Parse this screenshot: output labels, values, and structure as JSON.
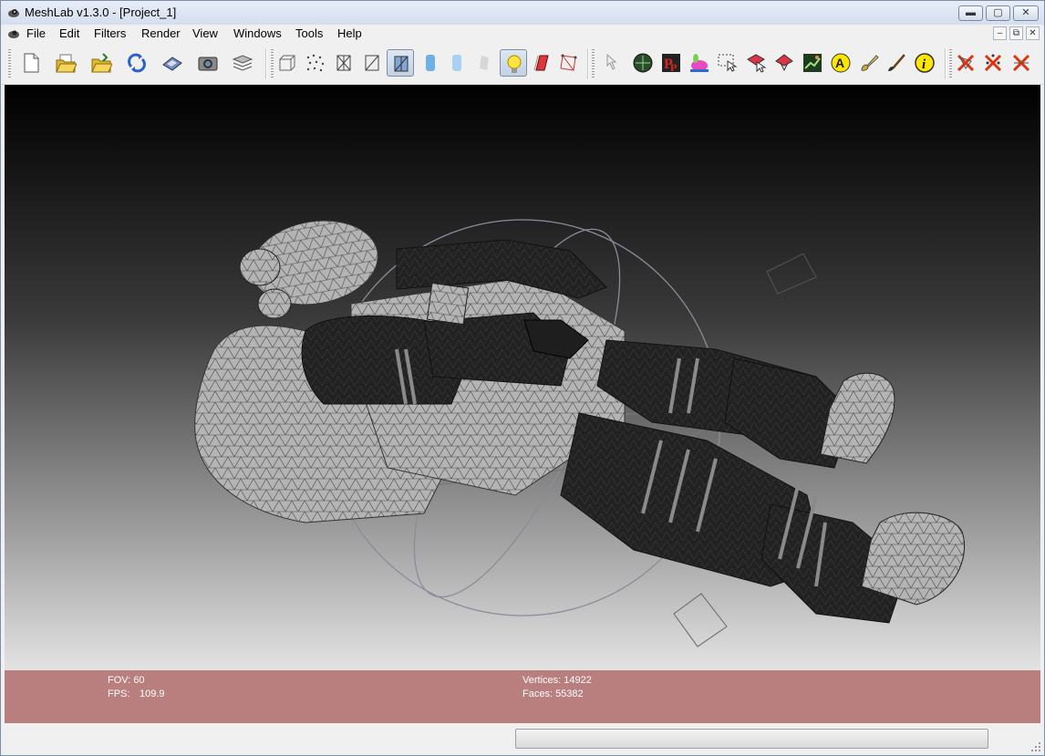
{
  "window": {
    "title": "MeshLab v1.3.0 - [Project_1]",
    "min_label": "▬",
    "max_label": "▢",
    "close_label": "✕"
  },
  "menu": {
    "items": [
      "File",
      "Edit",
      "Filters",
      "Render",
      "View",
      "Windows",
      "Tools",
      "Help"
    ],
    "mdi_min": "–",
    "mdi_restore": "⧉",
    "mdi_close": "✕"
  },
  "toolbar": {
    "icons": [
      "new-project-icon",
      "open-project-icon",
      "import-mesh-icon",
      "reload-icon",
      "save-icon",
      "snapshot-icon",
      "layers-icon",
      "bbox-render-icon",
      "points-render-icon",
      "wireframe-render-icon",
      "hiddenlines-render-icon",
      "flatlines-render-icon",
      "flat-render-icon",
      "smooth-render-icon",
      "texture-render-icon",
      "lighting-icon",
      "backface-cull-icon",
      "select-faces-render-icon",
      "manipulator-icon",
      "measure-icon",
      "pickpoints-icon",
      "paint-bunny-icon",
      "select-region-icon",
      "select-vertices-icon",
      "select-connected-icon",
      "raster-align-icon",
      "annotation-icon",
      "brush-icon",
      "paintbrush-icon",
      "info-icon",
      "delete-faces-icon",
      "delete-vertices-icon",
      "delete-all-icon"
    ],
    "active": [
      "flatlines-render-icon",
      "lighting-icon"
    ]
  },
  "viewport": {
    "background_top": "#000000",
    "background_bottom": "#e3e3e3",
    "model": "astronaut wireframe mesh"
  },
  "info": {
    "fov_label": "FOV: 60",
    "fps_label": "FPS:",
    "fps_value": "109.9",
    "vertices_label": "Vertices: 14922",
    "faces_label": "Faces: 55382",
    "panel_color": "#b97e7e"
  },
  "status": {
    "progress_fraction": 0
  }
}
